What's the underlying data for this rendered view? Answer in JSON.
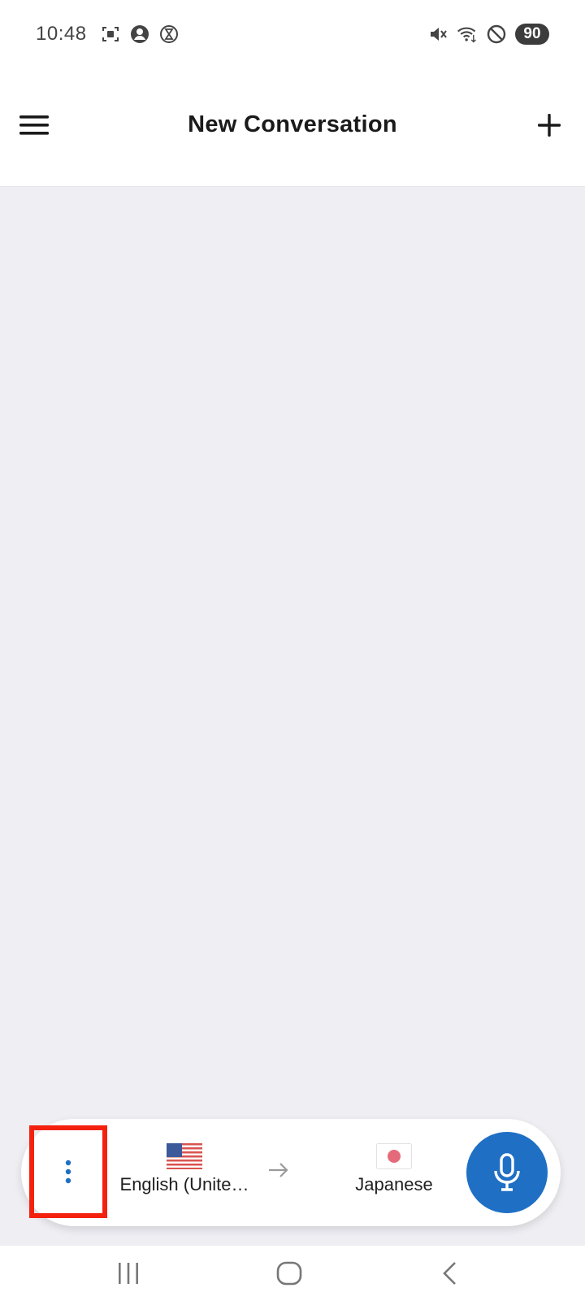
{
  "status_bar": {
    "time": "10:48",
    "battery": "90",
    "left_icons": [
      "screenshot-icon",
      "account-icon",
      "hourglass-icon"
    ],
    "right_icons": [
      "mute-icon",
      "wifi-icon",
      "do-not-disturb-icon"
    ]
  },
  "header": {
    "title": "New Conversation",
    "menu_icon": "hamburger-menu-icon",
    "add_icon": "plus-icon"
  },
  "controls": {
    "more_icon": "more-vertical-icon",
    "source_language": {
      "label": "English (Unite…",
      "flag": "us-flag-icon"
    },
    "target_language": {
      "label": "Japanese",
      "flag": "japan-flag-icon"
    },
    "arrow_icon": "arrow-right-icon",
    "mic_icon": "microphone-icon"
  },
  "colors": {
    "accent": "#1f6fc4",
    "background": "#eeeef3",
    "highlight_box": "#f4210f"
  },
  "nav_bar": {
    "icons": [
      "recent-apps-icon",
      "home-icon",
      "back-icon"
    ]
  }
}
